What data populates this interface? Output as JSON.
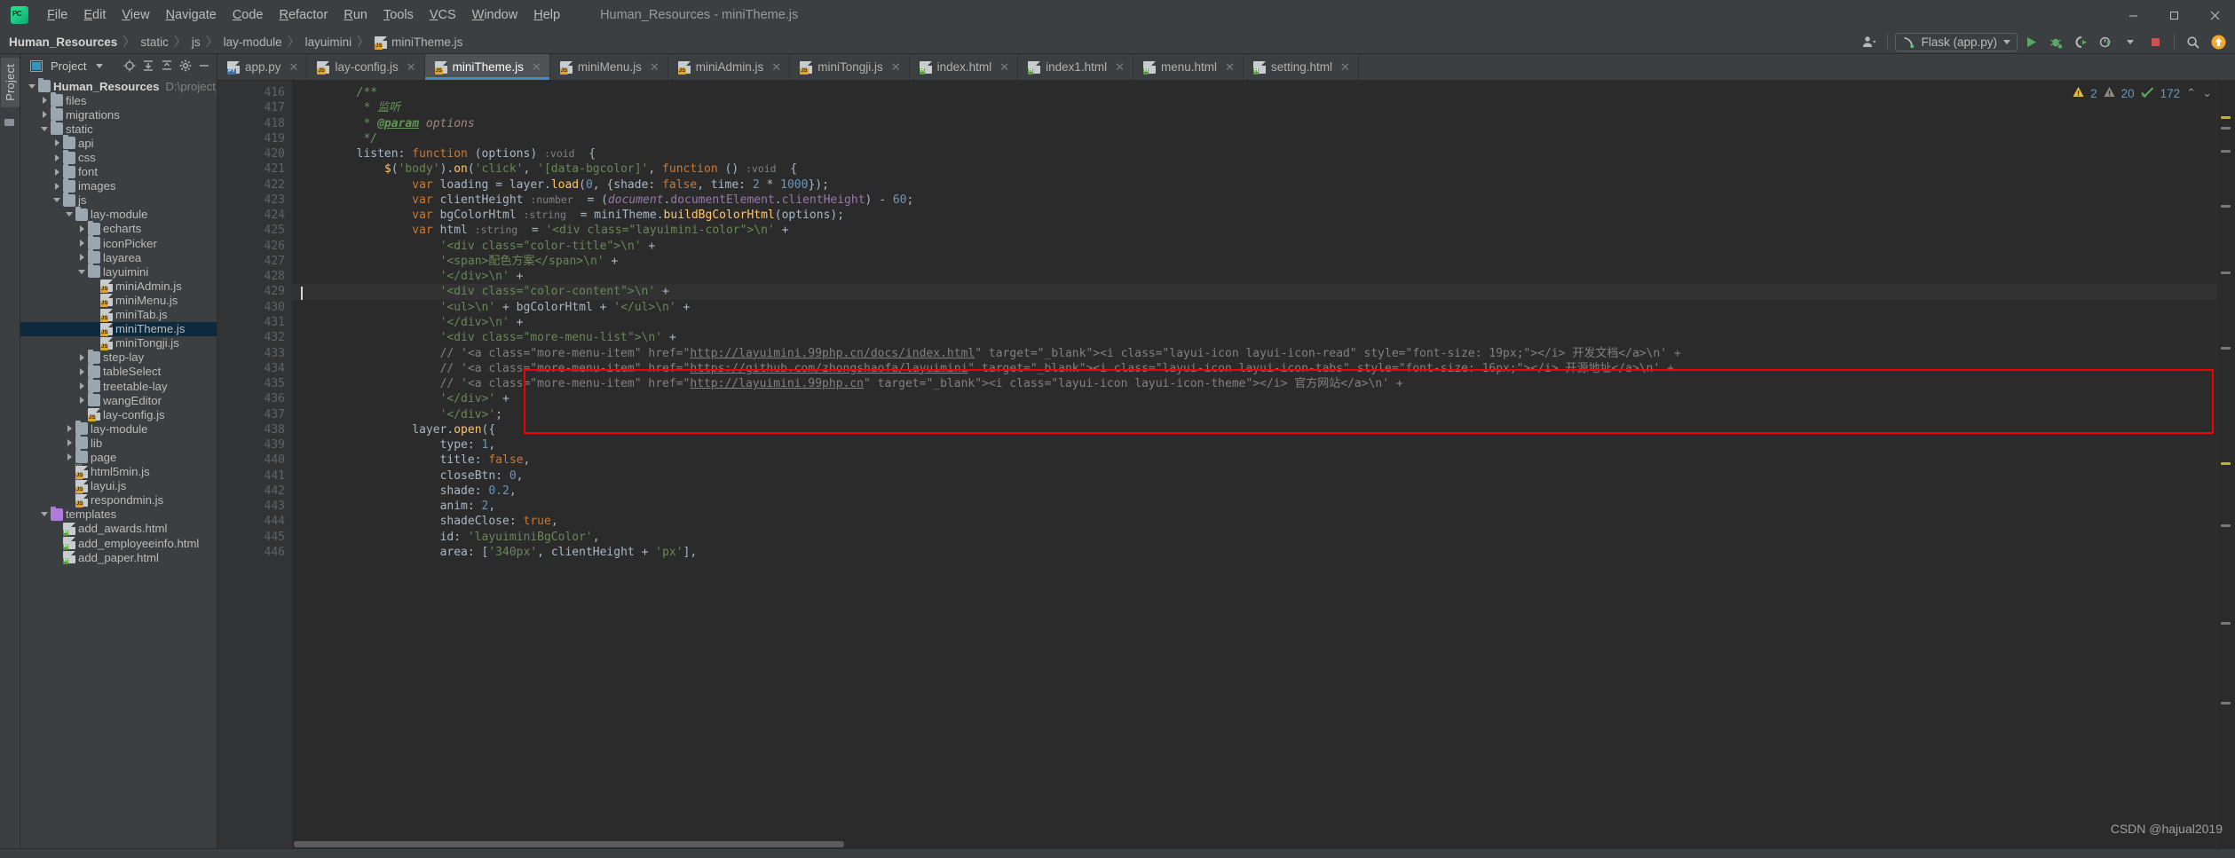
{
  "window": {
    "title": "Human_Resources - miniTheme.js",
    "minimize_label": "─",
    "maximize_label": "☐",
    "close_label": "✕"
  },
  "menu": {
    "items": [
      "File",
      "Edit",
      "View",
      "Navigate",
      "Code",
      "Refactor",
      "Run",
      "Tools",
      "VCS",
      "Window",
      "Help"
    ]
  },
  "breadcrumb": {
    "items": [
      "Human_Resources",
      "static",
      "js",
      "lay-module",
      "layuimini",
      "miniTheme.js"
    ],
    "separator": "〉"
  },
  "toolbar": {
    "run_config": "Flask (app.py)",
    "icons": [
      "user-avatar-icon",
      "run-icon",
      "debug-icon",
      "run-coverage-icon",
      "profile-icon",
      "stop-icon",
      "search-everywhere-icon",
      "update-project-icon"
    ]
  },
  "project_panel": {
    "tool_tab": "Project",
    "title": "Project",
    "header_icons": [
      "locate-icon",
      "expand-all-icon",
      "collapse-all-icon",
      "settings-gear-icon",
      "hide-icon"
    ],
    "tree": [
      {
        "depth": 0,
        "twisty": "open",
        "icon": "folder",
        "label": "Human_Resources",
        "bold": true,
        "path": "D:\\project_code\\H"
      },
      {
        "depth": 1,
        "twisty": "closed",
        "icon": "folder",
        "label": "files"
      },
      {
        "depth": 1,
        "twisty": "closed",
        "icon": "folder",
        "label": "migrations"
      },
      {
        "depth": 1,
        "twisty": "open",
        "icon": "folder",
        "label": "static"
      },
      {
        "depth": 2,
        "twisty": "closed",
        "icon": "folder",
        "label": "api"
      },
      {
        "depth": 2,
        "twisty": "closed",
        "icon": "folder",
        "label": "css"
      },
      {
        "depth": 2,
        "twisty": "closed",
        "icon": "folder",
        "label": "font"
      },
      {
        "depth": 2,
        "twisty": "closed",
        "icon": "folder",
        "label": "images"
      },
      {
        "depth": 2,
        "twisty": "open",
        "icon": "folder",
        "label": "js"
      },
      {
        "depth": 3,
        "twisty": "open",
        "icon": "folder",
        "label": "lay-module"
      },
      {
        "depth": 4,
        "twisty": "closed",
        "icon": "folder",
        "label": "echarts"
      },
      {
        "depth": 4,
        "twisty": "closed",
        "icon": "folder",
        "label": "iconPicker"
      },
      {
        "depth": 4,
        "twisty": "closed",
        "icon": "folder",
        "label": "layarea"
      },
      {
        "depth": 4,
        "twisty": "open",
        "icon": "folder",
        "label": "layuimini"
      },
      {
        "depth": 5,
        "twisty": "none",
        "icon": "js-file",
        "label": "miniAdmin.js"
      },
      {
        "depth": 5,
        "twisty": "none",
        "icon": "js-file",
        "label": "miniMenu.js"
      },
      {
        "depth": 5,
        "twisty": "none",
        "icon": "js-file",
        "label": "miniTab.js"
      },
      {
        "depth": 5,
        "twisty": "none",
        "icon": "js-file",
        "label": "miniTheme.js",
        "selected": true
      },
      {
        "depth": 5,
        "twisty": "none",
        "icon": "js-file",
        "label": "miniTongji.js"
      },
      {
        "depth": 4,
        "twisty": "closed",
        "icon": "folder",
        "label": "step-lay"
      },
      {
        "depth": 4,
        "twisty": "closed",
        "icon": "folder",
        "label": "tableSelect"
      },
      {
        "depth": 4,
        "twisty": "closed",
        "icon": "folder",
        "label": "treetable-lay"
      },
      {
        "depth": 4,
        "twisty": "closed",
        "icon": "folder",
        "label": "wangEditor"
      },
      {
        "depth": 4,
        "twisty": "none",
        "icon": "js-file",
        "label": "lay-config.js"
      },
      {
        "depth": 3,
        "twisty": "closed",
        "icon": "folder",
        "label": "lay-module"
      },
      {
        "depth": 3,
        "twisty": "closed",
        "icon": "folder",
        "label": "lib"
      },
      {
        "depth": 3,
        "twisty": "closed",
        "icon": "folder",
        "label": "page"
      },
      {
        "depth": 3,
        "twisty": "none",
        "icon": "min-js-file",
        "label": "html5min.js"
      },
      {
        "depth": 3,
        "twisty": "none",
        "icon": "min-js-file",
        "label": "layui.js"
      },
      {
        "depth": 3,
        "twisty": "none",
        "icon": "min-js-file",
        "label": "respondmin.js"
      },
      {
        "depth": 1,
        "twisty": "open",
        "icon": "folder-purple",
        "label": "templates"
      },
      {
        "depth": 2,
        "twisty": "none",
        "icon": "html-file",
        "label": "add_awards.html"
      },
      {
        "depth": 2,
        "twisty": "none",
        "icon": "html-file",
        "label": "add_employeeinfo.html"
      },
      {
        "depth": 2,
        "twisty": "none",
        "icon": "html-file",
        "label": "add_paper.html"
      }
    ]
  },
  "editor_tabs": [
    {
      "label": "app.py",
      "icon": "py-file",
      "active": false
    },
    {
      "label": "lay-config.js",
      "icon": "js-file",
      "active": false
    },
    {
      "label": "miniTheme.js",
      "icon": "js-file",
      "active": true
    },
    {
      "label": "miniMenu.js",
      "icon": "js-file",
      "active": false
    },
    {
      "label": "miniAdmin.js",
      "icon": "js-file",
      "active": false
    },
    {
      "label": "miniTongji.js",
      "icon": "js-file",
      "active": false
    },
    {
      "label": "index.html",
      "icon": "html-file",
      "active": false
    },
    {
      "label": "index1.html",
      "icon": "html-file",
      "active": false
    },
    {
      "label": "menu.html",
      "icon": "html-file",
      "active": false
    },
    {
      "label": "setting.html",
      "icon": "html-file",
      "active": false
    }
  ],
  "inspection_widget": {
    "warning_icon": "warning-triangle-icon",
    "warning_count": "2",
    "weak_warning_icon": "weak-warning-triangle-icon",
    "weak_warning_count": "20",
    "ok_icon": "inspection-ok-icon",
    "typo_count": "172",
    "prev_label": "⌃",
    "next_label": "⌄"
  },
  "code": {
    "first_line_number": 416,
    "caret_line": 429,
    "lines": [
      {
        "n": 416,
        "fold": "start",
        "text": "        /**"
      },
      {
        "n": 417,
        "fold": "none",
        "text": "         * 监听"
      },
      {
        "n": 418,
        "fold": "none",
        "text": "         * @param options"
      },
      {
        "n": 419,
        "fold": "end",
        "text": "         */"
      },
      {
        "n": 420,
        "fold": "start",
        "text": "        listen: function (options) :void  {"
      },
      {
        "n": 421,
        "fold": "start",
        "text": "            $('body').on('click', '[data-bgcolor]', function () :void  {"
      },
      {
        "n": 422,
        "fold": "none",
        "text": "                var loading = layer.load(0, {shade: false, time: 2 * 1000});"
      },
      {
        "n": 423,
        "fold": "none",
        "text": "                var clientHeight :number  = (document.documentElement.clientHeight) - 60;"
      },
      {
        "n": 424,
        "fold": "none",
        "text": "                var bgColorHtml :string  = miniTheme.buildBgColorHtml(options);"
      },
      {
        "n": 425,
        "fold": "none",
        "text": "                var html :string  = '<div class=\"layuimini-color\">\\n' +"
      },
      {
        "n": 426,
        "fold": "none",
        "text": "                    '<div class=\"color-title\">\\n' +"
      },
      {
        "n": 427,
        "fold": "none",
        "text": "                    '<span>配色方案</span>\\n' +"
      },
      {
        "n": 428,
        "fold": "none",
        "text": "                    '</div>\\n' +"
      },
      {
        "n": 429,
        "fold": "none",
        "text": "                    '<div class=\"color-content\">\\n' +"
      },
      {
        "n": 430,
        "fold": "none",
        "text": "                    '<ul>\\n' + bgColorHtml + '</ul>\\n' +"
      },
      {
        "n": 431,
        "fold": "none",
        "text": "                    '</div>\\n' +"
      },
      {
        "n": 432,
        "fold": "none",
        "text": "                    '<div class=\"more-menu-list\">\\n' +"
      },
      {
        "n": 433,
        "fold": "none",
        "text": "                    // '<a class=\"more-menu-item\" href=\"http://layuimini.99php.cn/docs/index.html\" target=\"_blank\"><i class=\"layui-icon layui-icon-read\" style=\"font-size: 19px;\"></i> 开发文档</a>\\n' +"
      },
      {
        "n": 434,
        "fold": "none",
        "text": "                    // '<a class=\"more-menu-item\" href=\"https://github.com/zhongshaofa/layuimini\" target=\"_blank\"><i class=\"layui-icon layui-icon-tabs\" style=\"font-size: 16px;\"></i> 开源地址</a>\\n' +"
      },
      {
        "n": 435,
        "fold": "none",
        "text": "                    // '<a class=\"more-menu-item\" href=\"http://layuimini.99php.cn\" target=\"_blank\"><i class=\"layui-icon layui-icon-theme\"></i> 官方网站</a>\\n' +"
      },
      {
        "n": 436,
        "fold": "none",
        "text": "                    '</div>' +"
      },
      {
        "n": 437,
        "fold": "none",
        "text": "                    '</div>';"
      },
      {
        "n": 438,
        "fold": "start",
        "text": "                layer.open({"
      },
      {
        "n": 439,
        "fold": "none",
        "text": "                    type: 1,"
      },
      {
        "n": 440,
        "fold": "none",
        "text": "                    title: false,"
      },
      {
        "n": 441,
        "fold": "none",
        "text": "                    closeBtn: 0,"
      },
      {
        "n": 442,
        "fold": "none",
        "text": "                    shade: 0.2,"
      },
      {
        "n": 443,
        "fold": "none",
        "text": "                    anim: 2,"
      },
      {
        "n": 444,
        "fold": "none",
        "text": "                    shadeClose: true,"
      },
      {
        "n": 445,
        "fold": "none",
        "text": "                    id: 'layuiminiBgColor',"
      },
      {
        "n": 446,
        "fold": "none",
        "text": "                    area: ['340px', clientHeight + 'px'],"
      }
    ]
  },
  "watermark": "CSDN @hajual2019",
  "colors": {
    "accent": "#4a88c7",
    "editor_bg": "#2b2b2b",
    "chrome_bg": "#3c3f41",
    "gutter_bg": "#313335",
    "selection": "#0d293e",
    "highlight_box": "#f50000",
    "string": "#6a8759",
    "keyword": "#cc7832",
    "comment": "#808080",
    "number": "#6897bb",
    "function": "#ffc66d",
    "field": "#9876aa"
  }
}
